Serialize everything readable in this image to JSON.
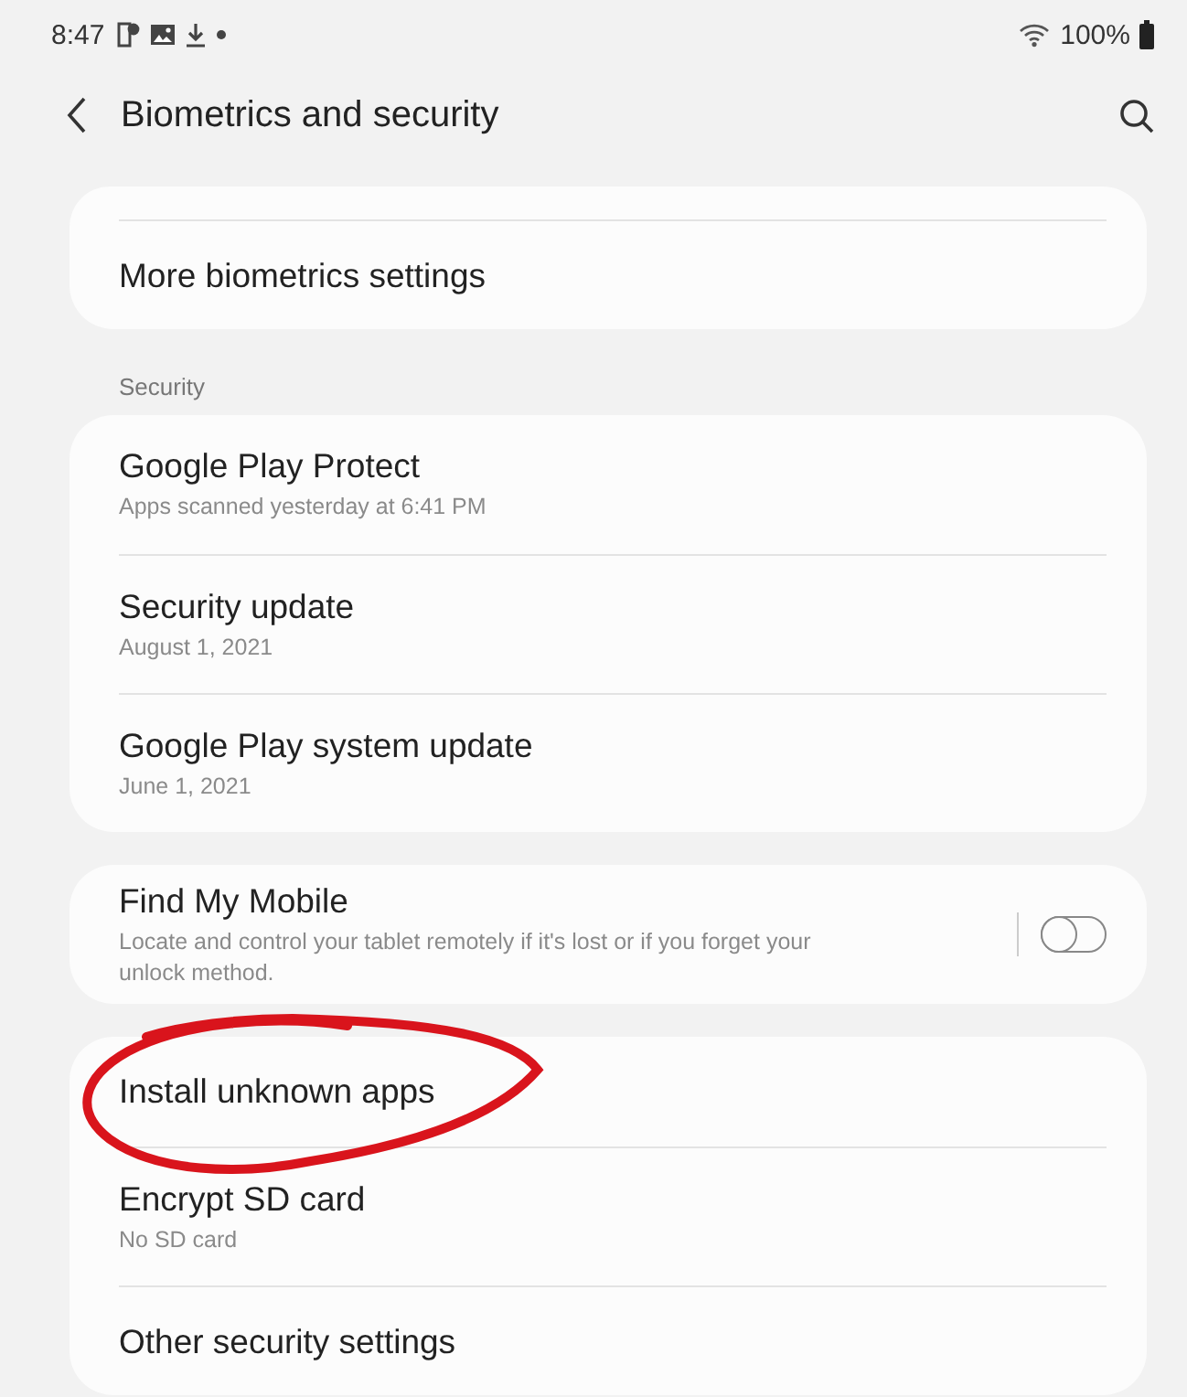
{
  "status_bar": {
    "time": "8:47",
    "battery": "100%"
  },
  "header": {
    "title": "Biometrics and security"
  },
  "sections": [
    {
      "items": [
        {
          "kind": "link",
          "title": "More biometrics settings",
          "circled": false
        }
      ]
    },
    {
      "label": "Security",
      "items": [
        {
          "kind": "link",
          "title": "Google Play Protect",
          "subtitle": "Apps scanned yesterday at 6:41 PM",
          "circled": false
        },
        {
          "kind": "link",
          "title": "Security update",
          "subtitle": "August 1, 2021",
          "circled": false
        },
        {
          "kind": "link",
          "title": "Google Play system update",
          "subtitle": "June 1, 2021",
          "circled": false
        }
      ]
    },
    {
      "items": [
        {
          "kind": "toggle",
          "title": "Find My Mobile",
          "subtitle": "Locate and control your tablet remotely if it's lost or if you forget your unlock method.",
          "on": false,
          "circled": false
        }
      ]
    },
    {
      "items": [
        {
          "kind": "link",
          "title": "Install unknown apps",
          "circled": true
        },
        {
          "kind": "link",
          "title": "Encrypt SD card",
          "subtitle": "No SD card",
          "circled": false
        },
        {
          "kind": "link",
          "title": "Other security settings",
          "circled": false
        }
      ]
    }
  ]
}
